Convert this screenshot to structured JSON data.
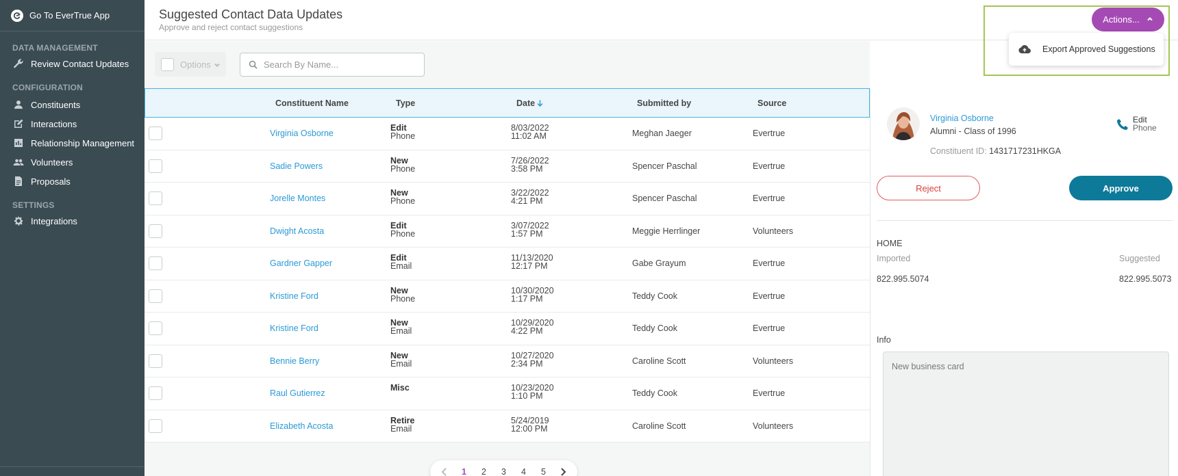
{
  "sidebar": {
    "top_link": "Go To EverTrue App",
    "sections": [
      {
        "title": "DATA MANAGEMENT",
        "items": [
          {
            "label": "Review Contact Updates",
            "icon": "wrench-icon"
          }
        ]
      },
      {
        "title": "CONFIGURATION",
        "items": [
          {
            "label": "Constituents",
            "icon": "person-icon"
          },
          {
            "label": "Interactions",
            "icon": "edit-icon"
          },
          {
            "label": "Relationship Management",
            "icon": "bar-chart-icon"
          },
          {
            "label": "Volunteers",
            "icon": "people-icon"
          },
          {
            "label": "Proposals",
            "icon": "document-icon"
          }
        ]
      },
      {
        "title": "SETTINGS",
        "items": [
          {
            "label": "Integrations",
            "icon": "gear-icon"
          }
        ]
      }
    ]
  },
  "header": {
    "title": "Suggested Contact Data Updates",
    "subtitle": "Approve and reject contact suggestions"
  },
  "actions": {
    "button_label": "Actions...",
    "menu_items": [
      {
        "label": "Export Approved Suggestions",
        "icon": "cloud-upload-icon"
      }
    ]
  },
  "toolbar": {
    "options_label": "Options",
    "search_placeholder": "Search By Name...",
    "search_value": ""
  },
  "table": {
    "columns": [
      "Constituent Name",
      "Type",
      "Date",
      "Submitted by",
      "Source"
    ],
    "sort_column": "Date",
    "sort_direction": "descending",
    "rows": [
      {
        "name": "Virginia Osborne",
        "type_action": "Edit",
        "type_field": "Phone",
        "date": "8/03/2022",
        "time": "11:02 AM",
        "submitted_by": "Meghan Jaeger",
        "source": "Evertrue"
      },
      {
        "name": "Sadie Powers",
        "type_action": "New",
        "type_field": "Phone",
        "date": "7/26/2022",
        "time": "3:58 PM",
        "submitted_by": "Spencer Paschal",
        "source": "Evertrue"
      },
      {
        "name": "Jorelle Montes",
        "type_action": "New",
        "type_field": "Phone",
        "date": "3/22/2022",
        "time": "4:21 PM",
        "submitted_by": "Spencer Paschal",
        "source": "Evertrue"
      },
      {
        "name": "Dwight Acosta",
        "type_action": "Edit",
        "type_field": "Phone",
        "date": "3/07/2022",
        "time": "1:57 PM",
        "submitted_by": "Meggie Herrlinger",
        "source": "Volunteers"
      },
      {
        "name": "Gardner Gapper",
        "type_action": "Edit",
        "type_field": "Email",
        "date": "11/13/2020",
        "time": "12:17 PM",
        "submitted_by": "Gabe Grayum",
        "source": "Evertrue"
      },
      {
        "name": "Kristine Ford",
        "type_action": "New",
        "type_field": "Phone",
        "date": "10/30/2020",
        "time": "1:17 PM",
        "submitted_by": "Teddy Cook",
        "source": "Evertrue"
      },
      {
        "name": "Kristine Ford",
        "type_action": "New",
        "type_field": "Email",
        "date": "10/29/2020",
        "time": "4:22 PM",
        "submitted_by": "Teddy Cook",
        "source": "Evertrue"
      },
      {
        "name": "Bennie Berry",
        "type_action": "New",
        "type_field": "Email",
        "date": "10/27/2020",
        "time": "2:34 PM",
        "submitted_by": "Caroline Scott",
        "source": "Volunteers"
      },
      {
        "name": "Raul Gutierrez",
        "type_action": "Misc",
        "type_field": "",
        "date": "10/23/2020",
        "time": "1:10 PM",
        "submitted_by": "Teddy Cook",
        "source": "Evertrue"
      },
      {
        "name": "Elizabeth Acosta",
        "type_action": "Retire",
        "type_field": "Email",
        "date": "5/24/2019",
        "time": "12:00 PM",
        "submitted_by": "Caroline Scott",
        "source": "Volunteers"
      }
    ]
  },
  "pagination": {
    "pages": [
      "1",
      "2",
      "3",
      "4",
      "5"
    ],
    "current": "1"
  },
  "detail": {
    "name": "Virginia Osborne",
    "class_info": "Alumni - Class of 1996",
    "constituent_id_label": "Constituent ID:",
    "constituent_id": "1431717231HKGA",
    "change_action": "Edit",
    "change_field": "Phone",
    "reject_label": "Reject",
    "approve_label": "Approve",
    "section_label": "HOME",
    "imported_label": "Imported",
    "suggested_label": "Suggested",
    "imported_value": "822.995.5074",
    "suggested_value": "822.995.5073",
    "info_label": "Info",
    "info_note": "New business card"
  },
  "colors": {
    "sidebar_bg": "#3b4b52",
    "accent_purple": "#a54ab5",
    "link_blue": "#2a9ad6",
    "approve_teal": "#0e7a9a",
    "reject_red": "#e35c5c",
    "highlight_green": "#a2c653"
  }
}
